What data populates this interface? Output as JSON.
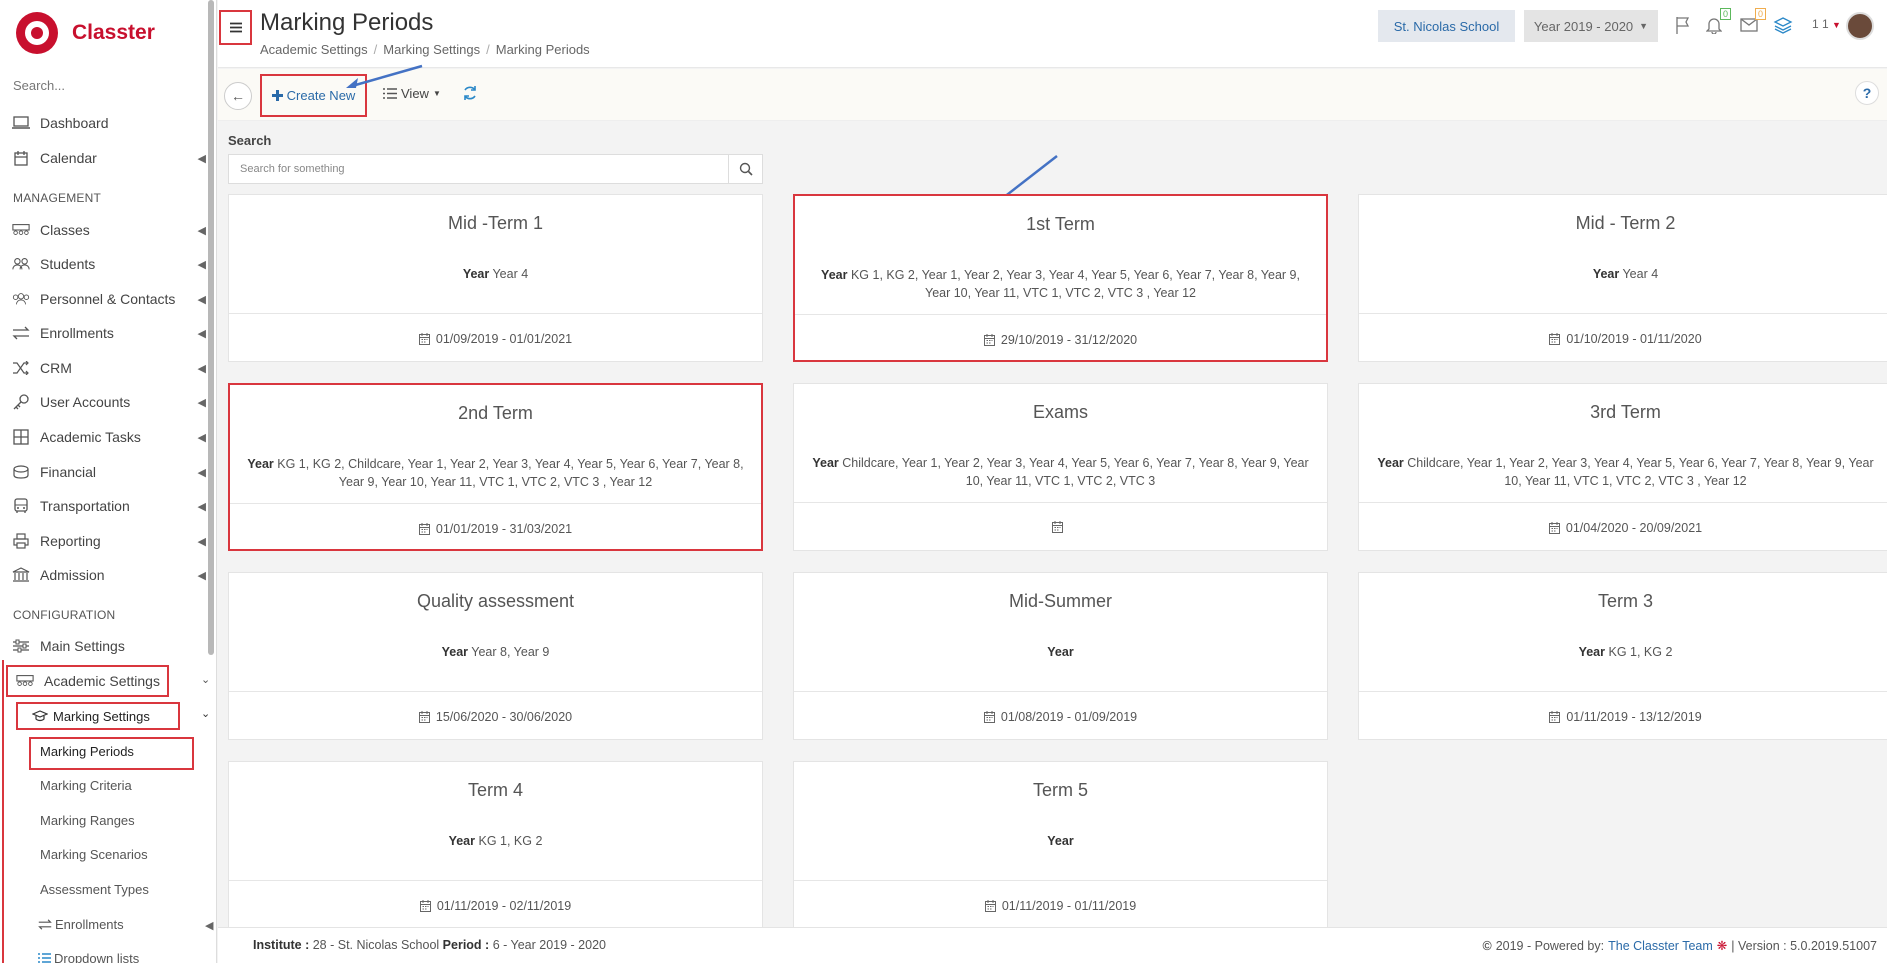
{
  "app": {
    "name": "Classter",
    "brand_color": "#c8102e",
    "accent_color": "#2a6aa8",
    "highlight_color": "#d9363e"
  },
  "sidebar": {
    "search_placeholder": "Search...",
    "items_top": [
      {
        "label": "Dashboard",
        "icon": "laptop-icon"
      },
      {
        "label": "Calendar",
        "icon": "calendar-icon"
      }
    ],
    "management_label": "MANAGEMENT",
    "management_items": [
      {
        "label": "Classes",
        "icon": "classroom-icon"
      },
      {
        "label": "Students",
        "icon": "students-icon"
      },
      {
        "label": "Personnel & Contacts",
        "icon": "people-icon"
      },
      {
        "label": "Enrollments",
        "icon": "exchange-icon"
      },
      {
        "label": "CRM",
        "icon": "shuffle-icon"
      },
      {
        "label": "User Accounts",
        "icon": "key-icon"
      },
      {
        "label": "Academic Tasks",
        "icon": "grid-icon"
      },
      {
        "label": "Financial",
        "icon": "money-icon"
      },
      {
        "label": "Transportation",
        "icon": "bus-icon"
      },
      {
        "label": "Reporting",
        "icon": "print-icon"
      },
      {
        "label": "Admission",
        "icon": "bank-icon"
      }
    ],
    "configuration_label": "CONFIGURATION",
    "config_items": [
      {
        "label": "Main Settings",
        "icon": "sliders-icon"
      },
      {
        "label": "Academic Settings",
        "icon": "classroom-icon"
      }
    ],
    "marking_settings_label": "Marking Settings",
    "marking_sub_items": [
      "Marking Periods",
      "Marking Criteria",
      "Marking Ranges",
      "Marking Scenarios",
      "Assessment Types"
    ],
    "enrollments_sub_label": "Enrollments",
    "dropdown_lists_label": "Dropdown lists"
  },
  "header": {
    "title": "Marking Periods",
    "breadcrumb": [
      "Academic Settings",
      "Marking Settings",
      "Marking Periods"
    ],
    "school": "St. Nicolas School",
    "year": "Year 2019 - 2020",
    "notification_count": "0",
    "message_count": "0",
    "user_count": "1 1"
  },
  "toolbar": {
    "create_new": "Create New",
    "view": "View",
    "help": "?"
  },
  "search": {
    "label": "Search",
    "placeholder": "Search for something"
  },
  "year_prefix": "Year",
  "cards": [
    {
      "title": "Mid -Term 1",
      "years": "Year 4",
      "dates": "01/09/2019 - 01/01/2021"
    },
    {
      "title": "1st Term",
      "years": "KG 1, KG 2, Year 1, Year 2, Year 3, Year 4, Year 5, Year 6, Year 7, Year 8, Year 9, Year 10, Year 11, VTC 1, VTC 2, VTC 3 , Year 12",
      "dates": "29/10/2019 - 31/12/2020"
    },
    {
      "title": "Mid - Term 2",
      "years": "Year 4",
      "dates": "01/10/2019 - 01/11/2020"
    },
    {
      "title": "2nd Term",
      "years": "KG 1, KG 2, Childcare, Year 1, Year 2, Year 3, Year 4, Year 5, Year 6, Year 7, Year 8, Year 9, Year 10, Year 11, VTC 1, VTC 2, VTC 3 , Year 12",
      "dates": "01/01/2019 - 31/03/2021"
    },
    {
      "title": "Exams",
      "years": "Childcare, Year 1, Year 2, Year 3, Year 4, Year 5, Year 6, Year 7, Year 8, Year 9, Year 10, Year 11, VTC 1, VTC 2, VTC 3",
      "dates": ""
    },
    {
      "title": "3rd Term",
      "years": "Childcare, Year 1, Year 2, Year 3, Year 4, Year 5, Year 6, Year 7, Year 8, Year 9, Year 10, Year 11, VTC 1, VTC 2, VTC 3 , Year 12",
      "dates": "01/04/2020 - 20/09/2021"
    },
    {
      "title": "Quality assessment",
      "years": "Year 8, Year 9",
      "dates": "15/06/2020 - 30/06/2020"
    },
    {
      "title": "Mid-Summer",
      "years": "",
      "dates": "01/08/2019 - 01/09/2019"
    },
    {
      "title": "Term 3",
      "years": "KG 1, KG 2",
      "dates": "01/11/2019 - 13/12/2019"
    },
    {
      "title": "Term 4",
      "years": "KG 1, KG 2",
      "dates": "01/11/2019 - 02/11/2019"
    },
    {
      "title": "Term 5",
      "years": "",
      "dates": "01/11/2019 - 01/11/2019"
    }
  ],
  "footer": {
    "institute_label": "Institute :",
    "institute_value": "28 - St. Nicolas School",
    "period_label": "Period :",
    "period_value": "6 - Year 2019 - 2020",
    "copyright": "2019 - Powered by:",
    "team": "The Classter Team",
    "version": "| Version : 5.0.2019.51007"
  }
}
